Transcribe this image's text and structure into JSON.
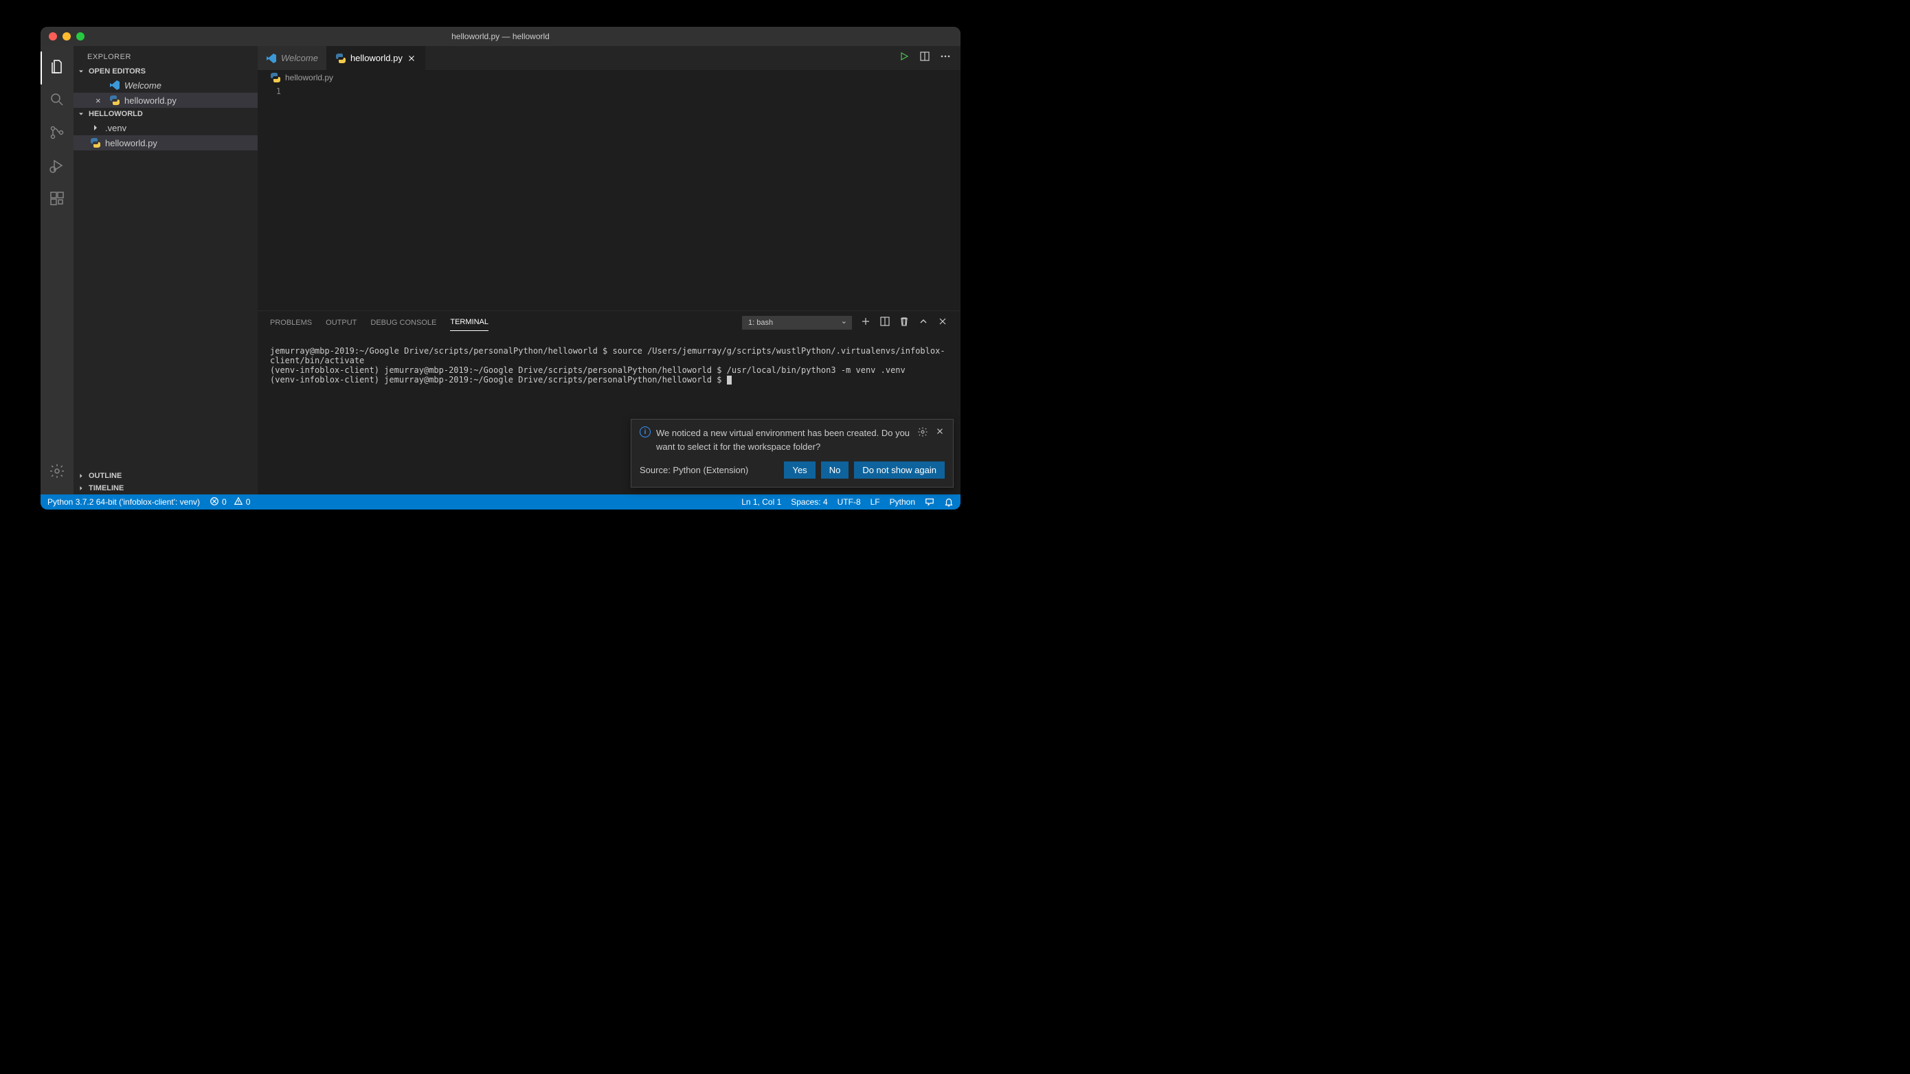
{
  "window": {
    "title": "helloworld.py — helloworld"
  },
  "sidebar": {
    "title": "EXPLORER",
    "openEditors": {
      "label": "OPEN EDITORS",
      "items": [
        {
          "name": "Welcome",
          "italic": true,
          "icon": "vscode"
        },
        {
          "name": "helloworld.py",
          "icon": "python",
          "closeable": true
        }
      ]
    },
    "workspace": {
      "label": "HELLOWORLD",
      "items": [
        {
          "name": ".venv",
          "kind": "folder"
        },
        {
          "name": "helloworld.py",
          "kind": "file",
          "icon": "python",
          "selected": true
        }
      ]
    },
    "outline": {
      "label": "OUTLINE"
    },
    "timeline": {
      "label": "TIMELINE"
    }
  },
  "tabs": [
    {
      "name": "Welcome",
      "icon": "vscode",
      "italic": true
    },
    {
      "name": "helloworld.py",
      "icon": "python",
      "active": true,
      "closeable": true
    }
  ],
  "breadcrumbs": {
    "file": "helloworld.py"
  },
  "editor": {
    "lineNumbers": [
      "1"
    ]
  },
  "panel": {
    "tabs": [
      "PROBLEMS",
      "OUTPUT",
      "DEBUG CONSOLE",
      "TERMINAL"
    ],
    "active": "TERMINAL",
    "terminalSelect": "1: bash",
    "terminalLines": [
      "jemurray@mbp-2019:~/Google Drive/scripts/personalPython/helloworld $ source /Users/jemurray/g/scripts/wustlPython/.virtualenvs/infoblox-client/bin/activate",
      "(venv-infoblox-client) jemurray@mbp-2019:~/Google Drive/scripts/personalPython/helloworld $ /usr/local/bin/python3 -m venv .venv",
      "(venv-infoblox-client) jemurray@mbp-2019:~/Google Drive/scripts/personalPython/helloworld $ "
    ]
  },
  "notification": {
    "message": "We noticed a new virtual environment has been created. Do you want to select it for the workspace folder?",
    "source": "Source: Python (Extension)",
    "buttons": {
      "yes": "Yes",
      "no": "No",
      "never": "Do not show again"
    }
  },
  "status": {
    "python": "Python 3.7.2 64-bit ('infoblox-client': venv)",
    "errors": "0",
    "warnings": "0",
    "cursor": "Ln 1, Col 1",
    "spaces": "Spaces: 4",
    "encoding": "UTF-8",
    "eol": "LF",
    "lang": "Python"
  }
}
